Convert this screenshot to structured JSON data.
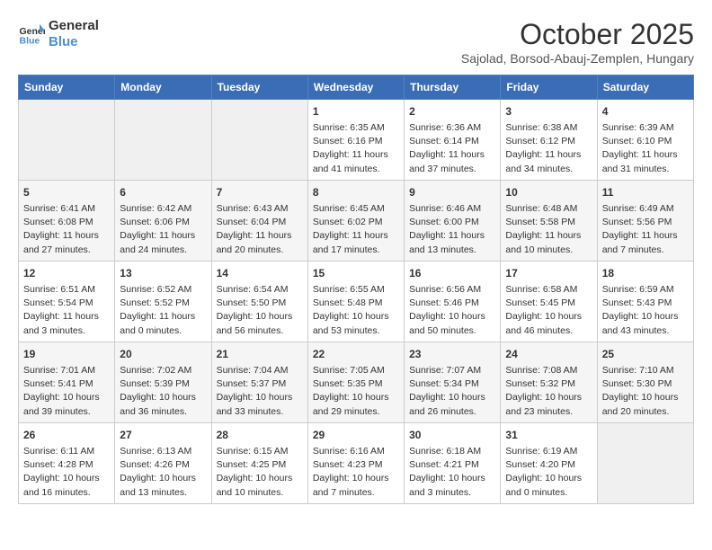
{
  "logo": {
    "line1": "General",
    "line2": "Blue"
  },
  "title": "October 2025",
  "subtitle": "Sajolad, Borsod-Abauj-Zemplen, Hungary",
  "headers": [
    "Sunday",
    "Monday",
    "Tuesday",
    "Wednesday",
    "Thursday",
    "Friday",
    "Saturday"
  ],
  "weeks": [
    [
      {
        "day": "",
        "info": ""
      },
      {
        "day": "",
        "info": ""
      },
      {
        "day": "",
        "info": ""
      },
      {
        "day": "1",
        "info": "Sunrise: 6:35 AM\nSunset: 6:16 PM\nDaylight: 11 hours\nand 41 minutes."
      },
      {
        "day": "2",
        "info": "Sunrise: 6:36 AM\nSunset: 6:14 PM\nDaylight: 11 hours\nand 37 minutes."
      },
      {
        "day": "3",
        "info": "Sunrise: 6:38 AM\nSunset: 6:12 PM\nDaylight: 11 hours\nand 34 minutes."
      },
      {
        "day": "4",
        "info": "Sunrise: 6:39 AM\nSunset: 6:10 PM\nDaylight: 11 hours\nand 31 minutes."
      }
    ],
    [
      {
        "day": "5",
        "info": "Sunrise: 6:41 AM\nSunset: 6:08 PM\nDaylight: 11 hours\nand 27 minutes."
      },
      {
        "day": "6",
        "info": "Sunrise: 6:42 AM\nSunset: 6:06 PM\nDaylight: 11 hours\nand 24 minutes."
      },
      {
        "day": "7",
        "info": "Sunrise: 6:43 AM\nSunset: 6:04 PM\nDaylight: 11 hours\nand 20 minutes."
      },
      {
        "day": "8",
        "info": "Sunrise: 6:45 AM\nSunset: 6:02 PM\nDaylight: 11 hours\nand 17 minutes."
      },
      {
        "day": "9",
        "info": "Sunrise: 6:46 AM\nSunset: 6:00 PM\nDaylight: 11 hours\nand 13 minutes."
      },
      {
        "day": "10",
        "info": "Sunrise: 6:48 AM\nSunset: 5:58 PM\nDaylight: 11 hours\nand 10 minutes."
      },
      {
        "day": "11",
        "info": "Sunrise: 6:49 AM\nSunset: 5:56 PM\nDaylight: 11 hours\nand 7 minutes."
      }
    ],
    [
      {
        "day": "12",
        "info": "Sunrise: 6:51 AM\nSunset: 5:54 PM\nDaylight: 11 hours\nand 3 minutes."
      },
      {
        "day": "13",
        "info": "Sunrise: 6:52 AM\nSunset: 5:52 PM\nDaylight: 11 hours\nand 0 minutes."
      },
      {
        "day": "14",
        "info": "Sunrise: 6:54 AM\nSunset: 5:50 PM\nDaylight: 10 hours\nand 56 minutes."
      },
      {
        "day": "15",
        "info": "Sunrise: 6:55 AM\nSunset: 5:48 PM\nDaylight: 10 hours\nand 53 minutes."
      },
      {
        "day": "16",
        "info": "Sunrise: 6:56 AM\nSunset: 5:46 PM\nDaylight: 10 hours\nand 50 minutes."
      },
      {
        "day": "17",
        "info": "Sunrise: 6:58 AM\nSunset: 5:45 PM\nDaylight: 10 hours\nand 46 minutes."
      },
      {
        "day": "18",
        "info": "Sunrise: 6:59 AM\nSunset: 5:43 PM\nDaylight: 10 hours\nand 43 minutes."
      }
    ],
    [
      {
        "day": "19",
        "info": "Sunrise: 7:01 AM\nSunset: 5:41 PM\nDaylight: 10 hours\nand 39 minutes."
      },
      {
        "day": "20",
        "info": "Sunrise: 7:02 AM\nSunset: 5:39 PM\nDaylight: 10 hours\nand 36 minutes."
      },
      {
        "day": "21",
        "info": "Sunrise: 7:04 AM\nSunset: 5:37 PM\nDaylight: 10 hours\nand 33 minutes."
      },
      {
        "day": "22",
        "info": "Sunrise: 7:05 AM\nSunset: 5:35 PM\nDaylight: 10 hours\nand 29 minutes."
      },
      {
        "day": "23",
        "info": "Sunrise: 7:07 AM\nSunset: 5:34 PM\nDaylight: 10 hours\nand 26 minutes."
      },
      {
        "day": "24",
        "info": "Sunrise: 7:08 AM\nSunset: 5:32 PM\nDaylight: 10 hours\nand 23 minutes."
      },
      {
        "day": "25",
        "info": "Sunrise: 7:10 AM\nSunset: 5:30 PM\nDaylight: 10 hours\nand 20 minutes."
      }
    ],
    [
      {
        "day": "26",
        "info": "Sunrise: 6:11 AM\nSunset: 4:28 PM\nDaylight: 10 hours\nand 16 minutes."
      },
      {
        "day": "27",
        "info": "Sunrise: 6:13 AM\nSunset: 4:26 PM\nDaylight: 10 hours\nand 13 minutes."
      },
      {
        "day": "28",
        "info": "Sunrise: 6:15 AM\nSunset: 4:25 PM\nDaylight: 10 hours\nand 10 minutes."
      },
      {
        "day": "29",
        "info": "Sunrise: 6:16 AM\nSunset: 4:23 PM\nDaylight: 10 hours\nand 7 minutes."
      },
      {
        "day": "30",
        "info": "Sunrise: 6:18 AM\nSunset: 4:21 PM\nDaylight: 10 hours\nand 3 minutes."
      },
      {
        "day": "31",
        "info": "Sunrise: 6:19 AM\nSunset: 4:20 PM\nDaylight: 10 hours\nand 0 minutes."
      },
      {
        "day": "",
        "info": ""
      }
    ]
  ]
}
